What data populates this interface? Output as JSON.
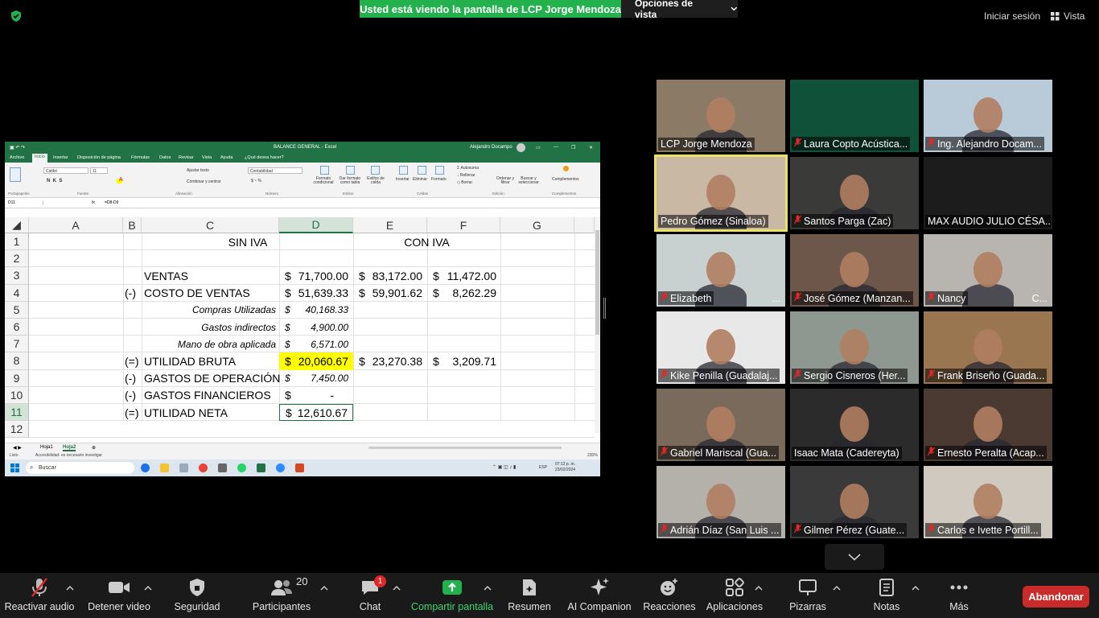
{
  "banner": {
    "viewing": "Usted está viendo la pantalla de LCP Jorge Mendoza",
    "view_options": "Opciones de vista",
    "sign_in": "Iniciar sesión",
    "view": "Vista"
  },
  "excel": {
    "title": "BALANCE GENERAL  -  Excel",
    "user": "Alejandro Docampo",
    "tabs": [
      "Archivo",
      "Inicio",
      "Insertar",
      "Disposición de página",
      "Fórmulas",
      "Datos",
      "Revisar",
      "Vista",
      "Ayuda",
      "¿Qué desea hacer?"
    ],
    "ribbon": {
      "font": "Calibri",
      "size": "11",
      "number_format": "Contabilidad",
      "wrap": "Ajustar texto",
      "merge": "Combinar y centrar",
      "cond_format": "Formato condicional",
      "table_format": "Dar formato como tabla",
      "cell_styles": "Estilos de celda",
      "insert": "Insertar",
      "delete": "Eliminar",
      "format": "Formato",
      "autosum": "Autosuma",
      "fill": "Rellenar",
      "clear": "Borrar",
      "sort": "Ordenar y filtrar",
      "find": "Buscar y seleccionar",
      "addins": "Complementos",
      "groups": [
        "Portapapeles",
        "Fuente",
        "Alineación",
        "Número",
        "Estilos",
        "Celdas",
        "Edición",
        "Complementos"
      ]
    },
    "name_box": "D11",
    "formula": "=D8-D9",
    "columns": [
      "A",
      "B",
      "C",
      "D",
      "E",
      "F",
      "G"
    ],
    "rows": [
      "1",
      "2",
      "3",
      "4",
      "5",
      "6",
      "7",
      "8",
      "9",
      "10",
      "11",
      "12"
    ],
    "headers": {
      "sin_iva": "SIN IVA",
      "con_iva": "CON IVA"
    },
    "lines": [
      {
        "row": 3,
        "sign": "",
        "label": "VENTAS",
        "d": "71,700.00",
        "e": "83,172.00",
        "f": "11,472.00"
      },
      {
        "row": 4,
        "sign": "(-)",
        "label": "COSTO DE VENTAS",
        "d": "51,639.33",
        "e": "59,901.62",
        "f": "8,262.29"
      },
      {
        "row": 5,
        "sign": "",
        "label": "Compras Utilizadas",
        "d": "40,168.33",
        "e": "",
        "f": ""
      },
      {
        "row": 6,
        "sign": "",
        "label": "Gastos indirectos",
        "d": "4,900.00",
        "e": "",
        "f": ""
      },
      {
        "row": 7,
        "sign": "",
        "label": "Mano de obra aplicada",
        "d": "6,571.00",
        "e": "",
        "f": ""
      },
      {
        "row": 8,
        "sign": "(=)",
        "label": "UTILIDAD BRUTA",
        "d": "20,060.67",
        "e": "23,270.38",
        "f": "3,209.71"
      },
      {
        "row": 9,
        "sign": "(-)",
        "label": "GASTOS DE OPERACIÓN",
        "d": "7,450.00",
        "e": "",
        "f": ""
      },
      {
        "row": 10,
        "sign": "(-)",
        "label": "GASTOS FINANCIEROS",
        "d": "-",
        "e": "",
        "f": ""
      },
      {
        "row": 11,
        "sign": "(=)",
        "label": "UTILIDAD NETA",
        "d": "12,610.67",
        "e": "",
        "f": ""
      }
    ],
    "currency": "$",
    "sheets": [
      "Hoja1",
      "Hoja2"
    ],
    "status": "Accesibilidad: es necesario investigar",
    "status_left": "Listo",
    "zoom": "230%",
    "search": "Buscar",
    "clock_time": "07:12 p. m.",
    "clock_date": "23/02/2024",
    "lang": "ESP"
  },
  "participants": [
    {
      "name": "LCP Jorge Mendoza",
      "muted": false,
      "bg": "#8a7a66"
    },
    {
      "name": "Laura Copto Acústica...",
      "muted": true,
      "bg": "#10513a"
    },
    {
      "name": "Ing. Alejandro Docam...",
      "muted": true,
      "bg": "#b9cbd8"
    },
    {
      "name": "Pedro Gómez (Sinaloa)",
      "muted": false,
      "bg": "#c9b8a4"
    },
    {
      "name": "Santos Parga (Zac)",
      "muted": true,
      "bg": "#3a3a38"
    },
    {
      "name": "MAX AUDIO JULIO CÉSA...",
      "muted": false,
      "bg": "#1c1c1c"
    },
    {
      "name": "Elizabeth",
      "muted": true,
      "bg": "#c8d0d0"
    },
    {
      "name": "José Gómez (Manzan...",
      "muted": true,
      "bg": "#6d564a"
    },
    {
      "name": "Nancy",
      "muted": true,
      "bg": "#b8b4b0"
    },
    {
      "name": "Kike Penilla (Guadalaj...",
      "muted": true,
      "bg": "#e8e8e8"
    },
    {
      "name": "Sergio Cisneros (Her...",
      "muted": true,
      "bg": "#8e9890"
    },
    {
      "name": "Frank Briseño (Guada...",
      "muted": true,
      "bg": "#9a7650"
    },
    {
      "name": "Gabriel Mariscal (Gua...",
      "muted": true,
      "bg": "#7a6a5c"
    },
    {
      "name": "Isaac Mata (Cadereyta)",
      "muted": false,
      "bg": "#2b2b2b"
    },
    {
      "name": "Ernesto Peralta (Acap...",
      "muted": true,
      "bg": "#4a3a32"
    },
    {
      "name": "Adrián Díaz (San Luis ...",
      "muted": true,
      "bg": "#b4b0aa"
    },
    {
      "name": "Gilmer Pérez (Guate...",
      "muted": true,
      "bg": "#3a3a3a"
    },
    {
      "name": "Carlos e Ivette Portill...",
      "muted": true,
      "bg": "#cfc9bf"
    }
  ],
  "tile_extra": {
    "elizabeth_suffix": "...",
    "nancy_suffix": "C..."
  },
  "toolbar": {
    "audio": "Reactivar audio",
    "video": "Detener video",
    "security": "Seguridad",
    "participants": "Participantes",
    "participants_count": "20",
    "chat": "Chat",
    "chat_badge": "1",
    "share": "Compartir pantalla",
    "summary": "Resumen",
    "companion": "AI Companion",
    "reactions": "Reacciones",
    "apps": "Aplicaciones",
    "whiteboards": "Pizarras",
    "notes": "Notas",
    "more": "Más",
    "leave": "Abandonar"
  },
  "colors": {
    "zoom_green": "#23b14d",
    "excel_green": "#217346",
    "highlight": "#ffff00",
    "leave_red": "#c92a2a",
    "speaker_outline": "#e8e26a"
  }
}
